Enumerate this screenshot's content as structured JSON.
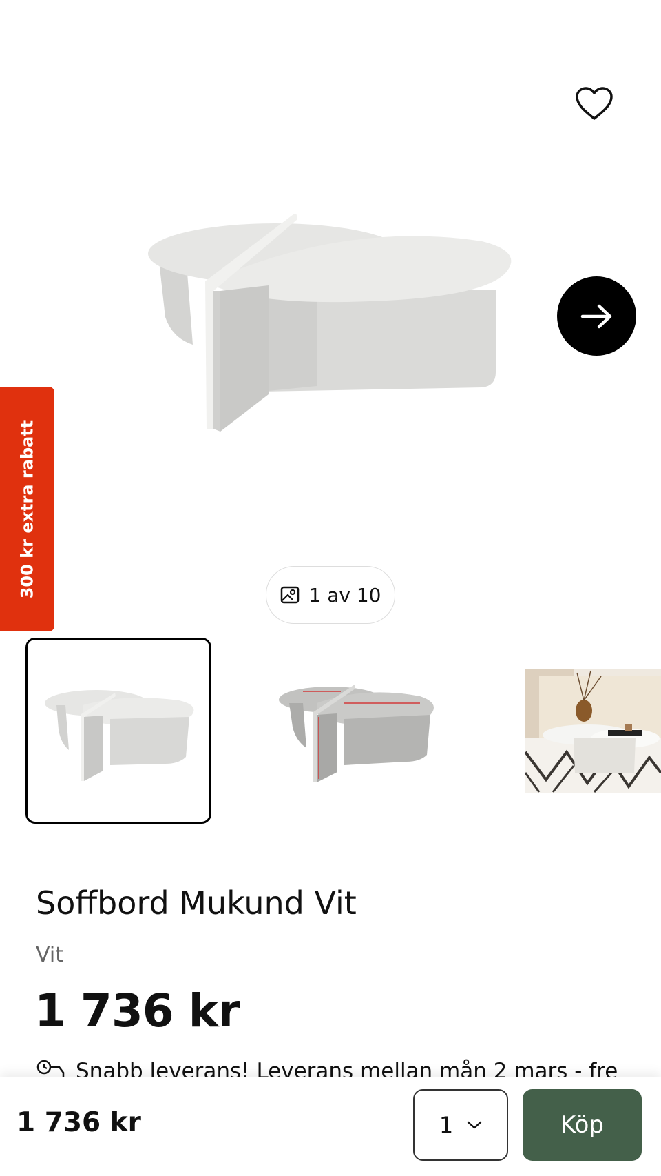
{
  "promo": {
    "label": "300 kr extra rabatt",
    "color": "#e0310e"
  },
  "gallery": {
    "counter": "1 av 10",
    "favorite_icon": "heart-icon",
    "next_icon": "arrow-right-icon",
    "thumbnails": [
      {
        "name": "thumbnail-front",
        "selected": true
      },
      {
        "name": "thumbnail-dimensions",
        "selected": false
      },
      {
        "name": "thumbnail-room",
        "selected": false
      }
    ]
  },
  "product": {
    "title": "Soffbord Mukund Vit",
    "variant": "Vit",
    "price": "1 736 kr"
  },
  "delivery": {
    "text": "Snabb leverans! Leverans mellan mån 2 mars - fre",
    "icon": "delivery-truck-icon"
  },
  "sticky_bar": {
    "price": "1 736 kr",
    "quantity": "1",
    "buy_label": "Köp",
    "buy_color": "#44604a"
  }
}
